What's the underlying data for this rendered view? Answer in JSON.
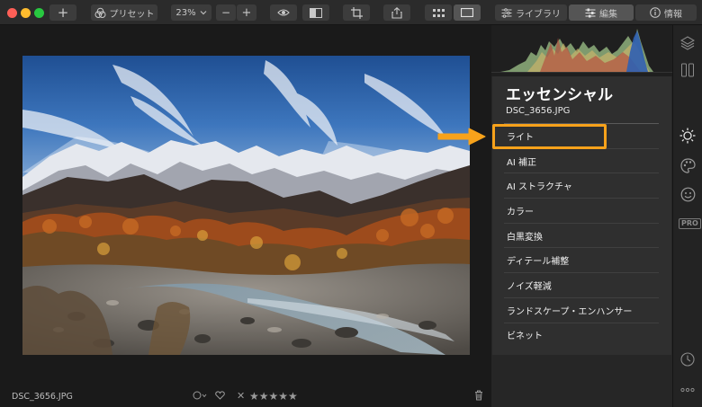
{
  "toolbar": {
    "add_label": "+",
    "preset_label": "プリセット",
    "zoom_value": "23%",
    "zoom_minus": "−",
    "zoom_plus": "+",
    "library_label": "ライブラリ",
    "edit_label": "編集",
    "info_label": "情報"
  },
  "photo": {
    "filename": "DSC_3656.JPG"
  },
  "bottom": {
    "rating_stars": "★★★★★",
    "reject_mark": "✕"
  },
  "panel": {
    "title": "エッセンシャル",
    "filename": "DSC_3656.JPG",
    "items": [
      {
        "label": "ライト"
      },
      {
        "label": "AI 補正"
      },
      {
        "label": "AI ストラクチャ"
      },
      {
        "label": "カラー"
      },
      {
        "label": "白黒変換"
      },
      {
        "label": "ディテール補整"
      },
      {
        "label": "ノイズ軽減"
      },
      {
        "label": "ランドスケープ・エンハンサー"
      },
      {
        "label": "ビネット"
      }
    ],
    "highlighted_item": "ライト",
    "highlight_color": "#f7a21b"
  },
  "rail": {
    "pro_label": "PRO",
    "icons": [
      "layers-icon",
      "compare-panels-icon",
      "sun-icon",
      "palette-icon",
      "smiley-icon",
      "pro-badge",
      "history-clock-icon",
      "more-icon"
    ]
  },
  "colors": {
    "accent": "#f7a21b",
    "background": "#1c1c1c",
    "panel": "#2f2f2f"
  }
}
